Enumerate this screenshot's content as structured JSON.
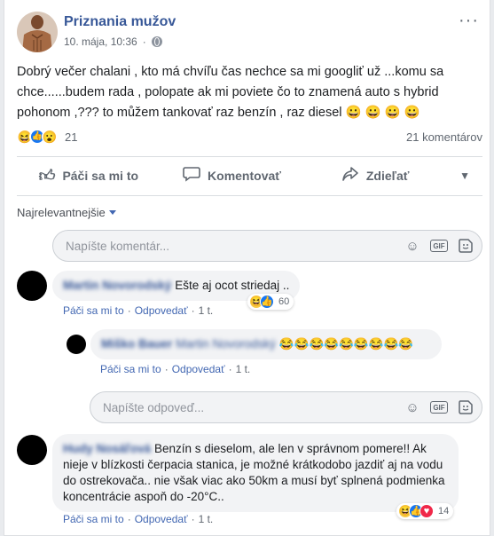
{
  "post": {
    "page_name": "Priznania mužov",
    "date": "10. mája, 10:36",
    "text": "Dobrý večer chalani , kto má chvíľu čas nechce sa mi googliť už ...komu sa chce......budem rada , polopate ak mi poviete čo to znamená auto s hybrid pohonom ,??? to můžem tankovať raz benzín , raz diesel 😀 😀 😀 😀",
    "reactions": {
      "icons": [
        "laugh",
        "like",
        "wow"
      ],
      "count": "21"
    },
    "comments_count": "21 komentárov"
  },
  "actions": {
    "like": "Páči sa mi to",
    "comment": "Komentovať",
    "share": "Zdieľať"
  },
  "sort_label": "Najrelevantnejšie",
  "compose": {
    "placeholder": "Napíšte komentár..."
  },
  "reply_compose": {
    "placeholder": "Napíšte odpoveď..."
  },
  "comments": [
    {
      "author": "Martin Novorodský",
      "text": "Ešte aj ocot striedaj ..",
      "like": "Páči sa mi to",
      "reply": "Odpovedať",
      "time": "1 t.",
      "reaction_count": "60",
      "reactions": [
        "laugh",
        "like"
      ]
    },
    {
      "author": "Miško Bauer",
      "mention": "Martin Novorodský",
      "text": "😂😂😂😂😂😂😂😂😂",
      "like": "Páči sa mi to",
      "reply": "Odpovedať",
      "time": "1 t."
    },
    {
      "author": "Hudy Nosáľová",
      "text": "Benzín s dieselom, ale len v správnom pomere!! Ak nieje v blízkosti čerpacia stanica, je možné krátkodobo jazdiť aj na vodu do ostrekovača.. nie však viac ako 50km a musí byť splnená podmienka koncentrácie aspoň do -20°C..",
      "like": "Páči sa mi to",
      "reply": "Odpovedať",
      "time": "1 t.",
      "reaction_count": "14",
      "reactions": [
        "laugh",
        "like",
        "love"
      ]
    }
  ],
  "colors": {
    "link": "#385898",
    "accent": "#4267b2",
    "bubble": "#f2f3f5"
  }
}
